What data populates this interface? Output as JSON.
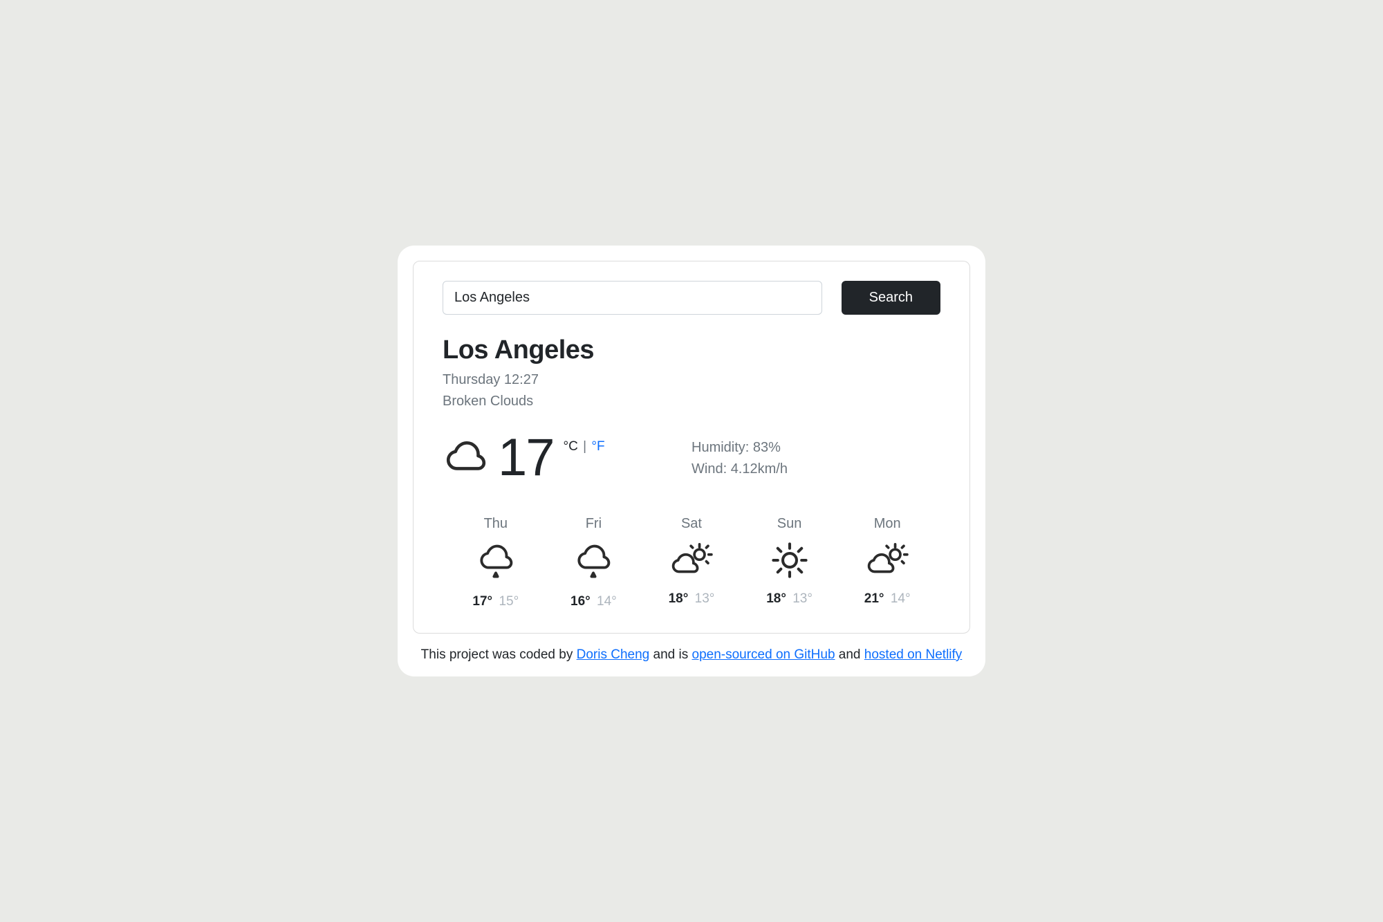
{
  "search": {
    "value": "Los Angeles",
    "button_label": "Search"
  },
  "current": {
    "city": "Los Angeles",
    "datetime": "Thursday 12:27",
    "description": "Broken Clouds",
    "icon": "cloud-icon",
    "temp": "17",
    "unit_c": "°C",
    "unit_sep": "|",
    "unit_f": "°F",
    "humidity_label": "Humidity:",
    "humidity_value": "83%",
    "wind_label": "Wind:",
    "wind_value": "4.12km/h"
  },
  "forecast": [
    {
      "day": "Thu",
      "icon": "rain-icon",
      "hi": "17°",
      "lo": "15°"
    },
    {
      "day": "Fri",
      "icon": "rain-icon",
      "hi": "16°",
      "lo": "14°"
    },
    {
      "day": "Sat",
      "icon": "partly-sun-icon",
      "hi": "18°",
      "lo": "13°"
    },
    {
      "day": "Sun",
      "icon": "sun-icon",
      "hi": "18°",
      "lo": "13°"
    },
    {
      "day": "Mon",
      "icon": "partly-sun-icon",
      "hi": "21°",
      "lo": "14°"
    }
  ],
  "footer": {
    "t1": "This project was coded by ",
    "author": "Doris Cheng",
    "t2": " and is ",
    "link_gh": "open-sourced on GitHub",
    "t3": " and ",
    "link_netlify": "hosted on Netlify"
  }
}
